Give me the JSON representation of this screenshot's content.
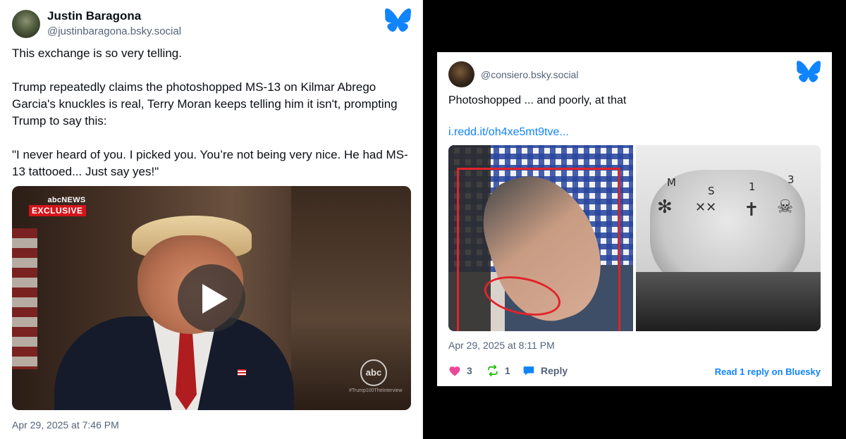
{
  "left_post": {
    "author_name": "Justin Baragona",
    "handle": "@justinbaragona.bsky.social",
    "paragraphs": [
      "This exchange is so very telling.",
      "Trump repeatedly claims the photoshopped MS-13 on Kilmar Abrego Garcia's knuckles is real, Terry Moran keeps telling him it isn't, prompting Trump to say this:",
      "\"I never heard of you. I picked you. You’re not being very nice. He had MS-13 tattooed... Just say yes!\""
    ],
    "video": {
      "network_logo": "abcNEWS",
      "exclusive_label": "EXCLUSIVE",
      "corner_logo": "abc",
      "hashtag": "#Trump100TheInterview",
      "play_icon": "play-icon"
    },
    "timestamp": "Apr 29, 2025 at 7:46 PM"
  },
  "right_post": {
    "handle": "@consiero.bsky.social",
    "text": "Photoshopped ... and poorly, at that",
    "link": "i.redd.it/oh4xe5mt9tve...",
    "knuckle_labels": [
      "M",
      "S",
      "1",
      "3"
    ],
    "timestamp": "Apr 29, 2025 at 8:11 PM",
    "likes": "3",
    "reposts": "1",
    "reply_label": "Reply",
    "read_more": "Read 1 reply on Bluesky"
  },
  "colors": {
    "bluesky_blue": "#1083fe",
    "like_pink": "#ec4899",
    "repost_green": "#20bc07",
    "secondary_text": "#53637a"
  }
}
